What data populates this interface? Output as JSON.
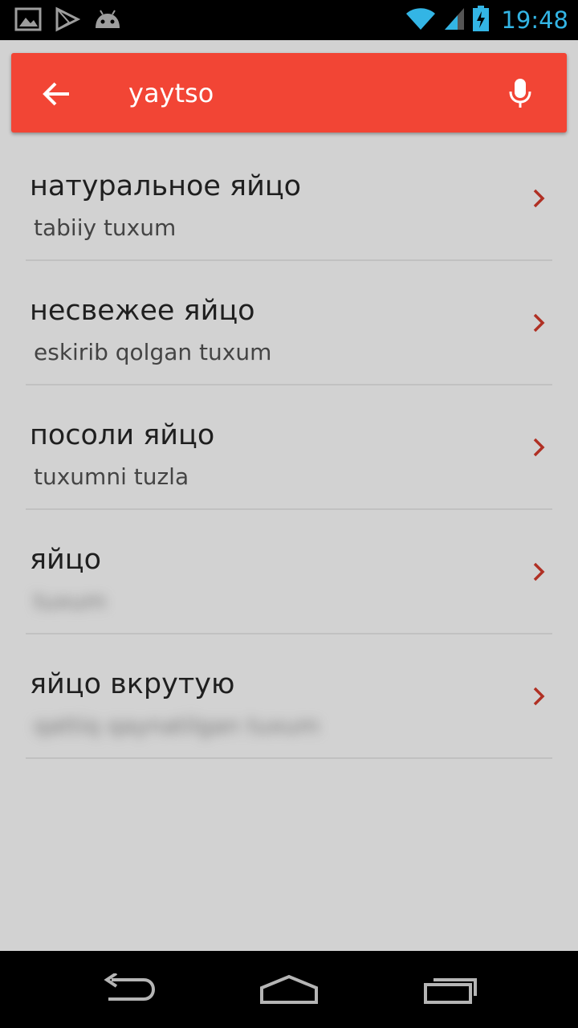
{
  "status_bar": {
    "time": "19:48",
    "icons_left": [
      "gallery-icon",
      "play-store-icon",
      "android-icon"
    ],
    "icons_right": [
      "wifi-icon",
      "signal-icon",
      "battery-charging-icon"
    ],
    "time_color": "#33b5e5"
  },
  "search": {
    "query": "yaytso",
    "back_icon": "arrow-left-icon",
    "mic_icon": "microphone-icon",
    "bar_color": "#f24535"
  },
  "results": [
    {
      "title": "натуральное яйцо",
      "subtitle": "tabiiy tuxum",
      "blurred": false
    },
    {
      "title": "несвежее яйцо",
      "subtitle": "eskirib qolgan tuxum",
      "blurred": false
    },
    {
      "title": "посоли яйцо",
      "subtitle": "tuxumni tuzla",
      "blurred": false
    },
    {
      "title": "яйцо",
      "subtitle": "tuxum",
      "blurred": true
    },
    {
      "title": "яйцо вкрутую",
      "subtitle": "qattiq qaynatilgan tuxum",
      "blurred": true
    }
  ],
  "nav_bar": {
    "icons": [
      "back-icon",
      "home-icon",
      "recent-apps-icon"
    ]
  },
  "colors": {
    "background": "#d2d2d2",
    "chevron": "#b03024",
    "divider": "#c1c1c1"
  }
}
